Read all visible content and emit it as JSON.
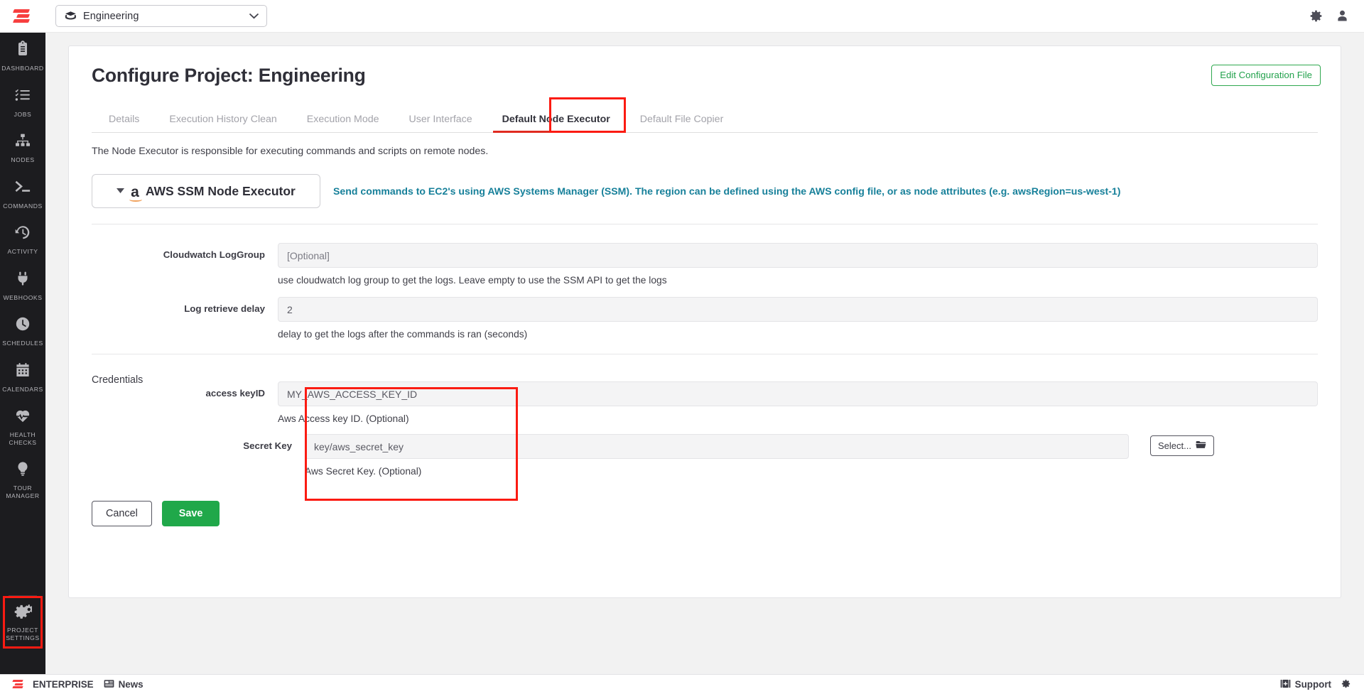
{
  "topbar": {
    "logo_name": "rundeck-logo",
    "project_selector": {
      "icon": "projects-folder-icon",
      "value": "Engineering",
      "chevron": "chevron-down-icon"
    },
    "icons": [
      {
        "name": "gear-icon",
        "label": "Settings"
      },
      {
        "name": "user-icon",
        "label": "User"
      }
    ]
  },
  "sidebar": {
    "items": [
      {
        "name": "dashboard",
        "label": "DASHBOARD",
        "icon": "clipboard-icon"
      },
      {
        "name": "jobs",
        "label": "JOBS",
        "icon": "checklist-icon"
      },
      {
        "name": "nodes",
        "label": "NODES",
        "icon": "sitemap-icon"
      },
      {
        "name": "commands",
        "label": "COMMANDS",
        "icon": "terminal-icon"
      },
      {
        "name": "activity",
        "label": "ACTIVITY",
        "icon": "history-icon"
      },
      {
        "name": "webhooks",
        "label": "WEBHOOKS",
        "icon": "plug-icon"
      },
      {
        "name": "schedules",
        "label": "SCHEDULES",
        "icon": "clock-icon"
      },
      {
        "name": "calendars",
        "label": "CALENDARS",
        "icon": "calendar-icon"
      },
      {
        "name": "health-checks",
        "label": "HEALTH CHECKS",
        "icon": "heartbeat-icon"
      },
      {
        "name": "tour-manager",
        "label": "TOUR MANAGER",
        "icon": "lightbulb-icon"
      }
    ],
    "bottom_item": {
      "name": "project-settings",
      "label": "PROJECT SETTINGS",
      "icon": "gears-icon",
      "highlighted": true
    }
  },
  "page": {
    "title": "Configure Project: Engineering",
    "edit_config_button": "Edit Configuration File"
  },
  "tabs": [
    {
      "label": "Details",
      "active": false
    },
    {
      "label": "Execution History Clean",
      "active": false
    },
    {
      "label": "Execution Mode",
      "active": false
    },
    {
      "label": "User Interface",
      "active": false
    },
    {
      "label": "Default Node Executor",
      "active": true
    },
    {
      "label": "Default File Copier",
      "active": false
    }
  ],
  "section": {
    "description": "The Node Executor is responsible for executing commands and scripts on remote nodes.",
    "executor": {
      "caret": "caret-down-icon",
      "badge": "aws-logo-icon",
      "name": "AWS SSM Node Executor",
      "description": "Send commands to EC2's using AWS Systems Manager (SSM). The region can be defined using the AWS config file, or as node attributes (e.g. awsRegion=us-west-1)"
    }
  },
  "fields": [
    {
      "label": "Cloudwatch LogGroup",
      "value": "",
      "placeholder": "[Optional]",
      "help": "use cloudwatch log group to get the logs. Leave empty to use the SSM API to get the logs"
    },
    {
      "label": "Log retrieve delay",
      "value": "2",
      "placeholder": "",
      "help": "delay to get the logs after the commands is ran (seconds)"
    }
  ],
  "credentials": {
    "title": "Credentials",
    "highlighted": true,
    "fields": [
      {
        "label": "access keyID",
        "value": "MY_AWS_ACCESS_KEY_ID",
        "help": "Aws Access key ID. (Optional)",
        "has_select_button": false
      },
      {
        "label": "Secret Key",
        "value": "key/aws_secret_key",
        "help": "Aws Secret Key. (Optional)",
        "has_select_button": true,
        "select_button_label": "Select...",
        "select_button_icon": "folder-icon"
      }
    ]
  },
  "actions": {
    "cancel_label": "Cancel",
    "save_label": "Save"
  },
  "footer": {
    "edition_label": "ENTERPRISE",
    "news_label": "News",
    "news_icon": "news-icon",
    "support_label": "Support",
    "support_icon": "support-icon",
    "settings_icon": "gear-icon"
  },
  "colors": {
    "accent_red": "#fb1b12",
    "brand_red": "#f73f3f",
    "green": "#20a84a",
    "teal": "#17809a",
    "sidebar_bg": "#1c1c1f"
  }
}
